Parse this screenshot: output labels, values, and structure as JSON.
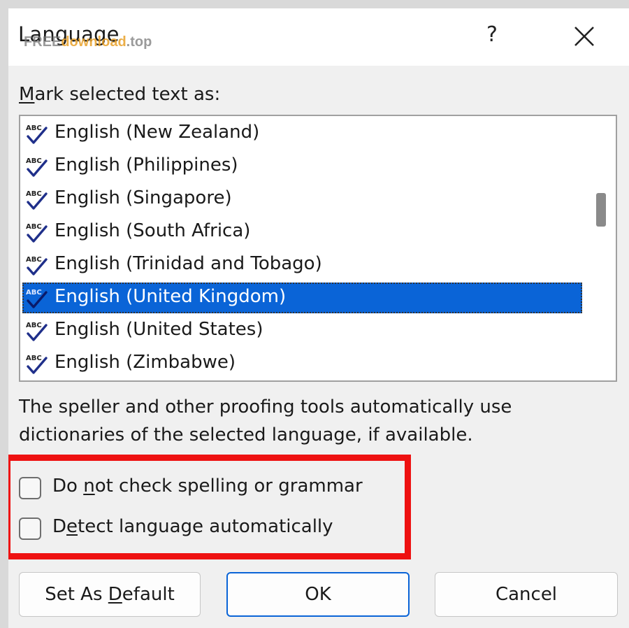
{
  "window": {
    "title": "Language",
    "help_label": "?",
    "watermark_part1": "FREE",
    "watermark_part2": "download",
    "watermark_part3": ".top"
  },
  "mark_label": {
    "prefix": "M",
    "rest": "ark selected text as:"
  },
  "languages": [
    {
      "label": "English (New Zealand)"
    },
    {
      "label": "English (Philippines)"
    },
    {
      "label": "English (Singapore)"
    },
    {
      "label": "English (South Africa)"
    },
    {
      "label": "English (Trinidad and Tobago)"
    },
    {
      "label": "English (United Kingdom)",
      "selected": true
    },
    {
      "label": "English (United States)"
    },
    {
      "label": "English (Zimbabwe)"
    }
  ],
  "info_text": "The speller and other proofing tools automatically use dictionaries of the selected language, if available.",
  "options": {
    "no_check": {
      "pre": "Do ",
      "ul": "n",
      "post": "ot check spelling or grammar",
      "checked": false
    },
    "detect": {
      "pre": "D",
      "ul": "e",
      "post": "tect language automatically",
      "checked": false
    }
  },
  "buttons": {
    "set_default_pre": "Set As ",
    "set_default_ul": "D",
    "set_default_post": "efault",
    "ok": "OK",
    "cancel": "Cancel"
  },
  "colors": {
    "selection": "#0a64d7",
    "highlight_border": "#ee1111",
    "icon_check": "#1f2f8a"
  }
}
